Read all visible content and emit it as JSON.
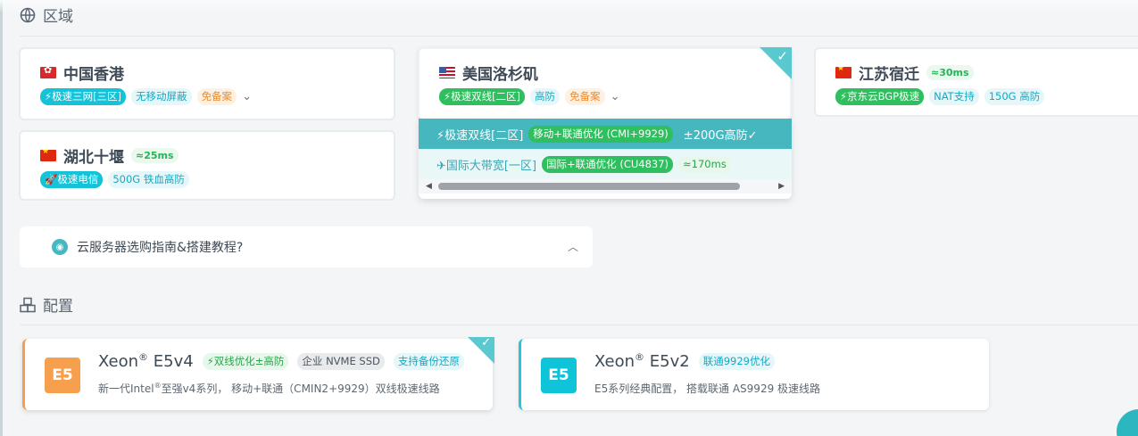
{
  "region": {
    "heading": "区域",
    "cards": [
      {
        "name": "中国香港",
        "flag": "hk",
        "tags": [
          "⚡极速三网[三区]",
          "无移动屏蔽",
          "免备案"
        ]
      },
      {
        "name": "美国洛杉矶",
        "flag": "us",
        "tags": [
          "⚡极速双线[二区]",
          "高防",
          "免备案"
        ],
        "selected": true
      },
      {
        "name": "江苏宿迁",
        "flag": "cn",
        "ping": "≈30ms",
        "tags": [
          "⚡京东云BGP极速",
          "NAT支持",
          "150G 高防"
        ]
      },
      {
        "name": "湖北十堰",
        "flag": "cn",
        "ping": "≈25ms",
        "tags": [
          "🚀极速电信",
          "500G 铁血高防"
        ]
      }
    ],
    "chevron": "⌄",
    "dropdown": [
      {
        "label": "⚡极速双线[二区]",
        "tag": "移动+联通优化 (CMI+9929)",
        "extra": "±200G高防✓"
      },
      {
        "label": "✈国际大带宽[一区]",
        "tag": "国际+联通优化 (CU4837)",
        "extra": "≈170ms"
      }
    ]
  },
  "guide": {
    "text": "云服务器选购指南&搭建教程?",
    "chevron": "︿"
  },
  "config": {
    "heading": "配置",
    "cards": [
      {
        "badge": "E5",
        "title": "Xeon",
        "reg": "®",
        "model": "E5v4",
        "tags": [
          "⚡双线优化±高防",
          "企业 NVME SSD",
          "支持备份还原"
        ],
        "desc_a": "新一代Intel",
        "desc_reg": "®",
        "desc_b": "至强v4系列， 移动+联通（CMIN2+9929）双线极速线路"
      },
      {
        "badge": "E5",
        "title": "Xeon",
        "reg": "®",
        "model": "E5v2",
        "tags": [
          "联通9929优化"
        ],
        "desc": "E5系列经典配置， 搭载联通 AS9929 极速线路"
      }
    ]
  },
  "colors": {
    "accent": "#46b6bf",
    "green": "#2fbf5e",
    "cyan": "#14c3d8",
    "orange": "#f3a04d"
  }
}
